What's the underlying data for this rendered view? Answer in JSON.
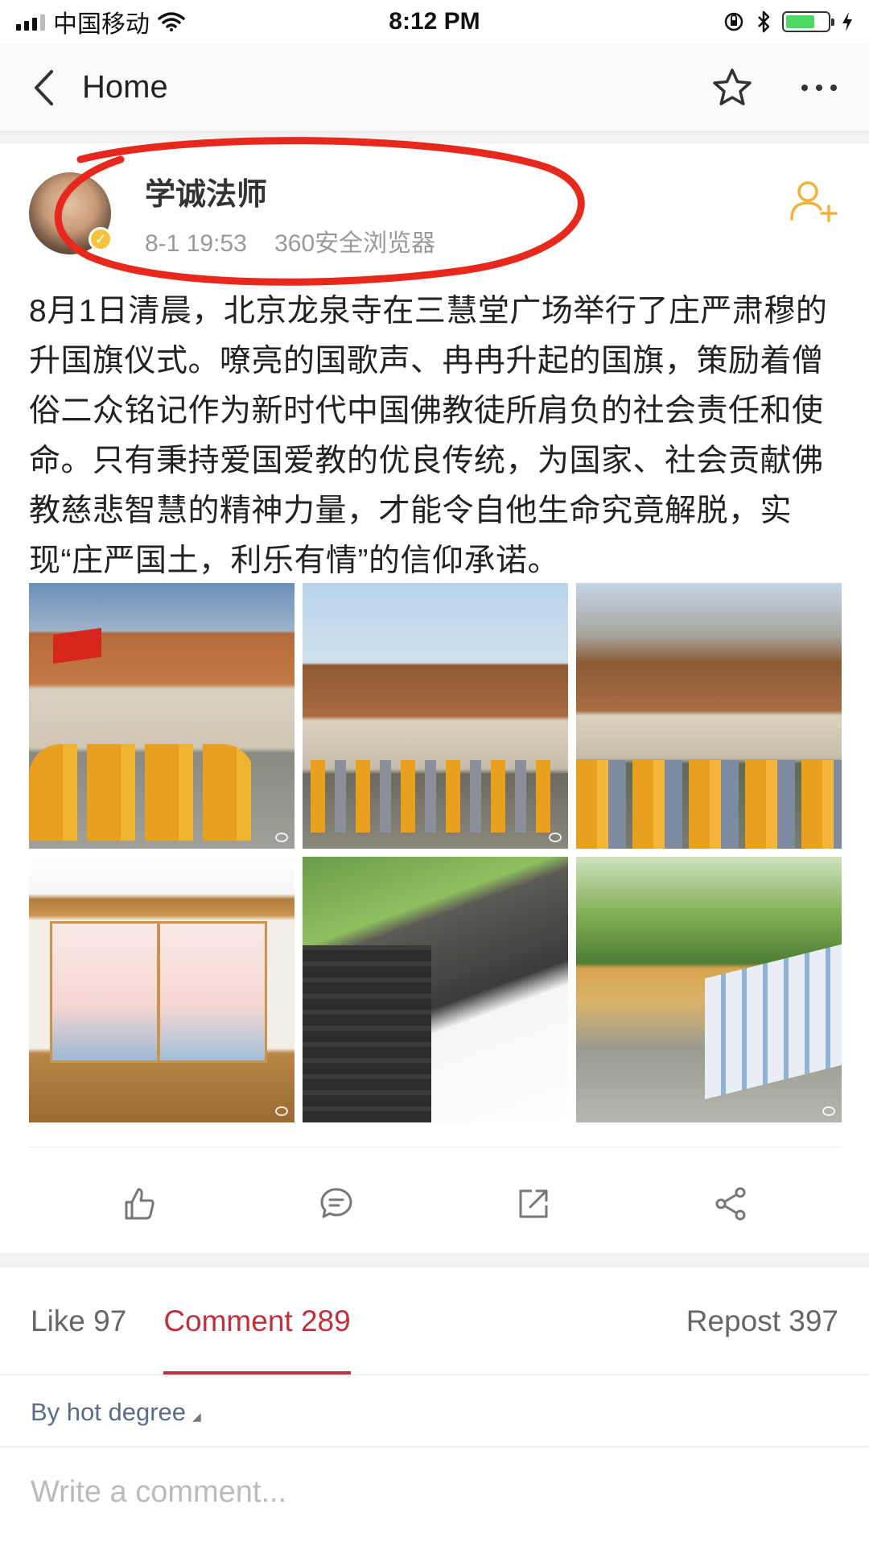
{
  "status_bar": {
    "carrier": "中国移动",
    "time": "8:12 PM",
    "signal_icon": "signal-icon",
    "wifi_icon": "wifi-icon",
    "battery_level": 0.7,
    "battery_color": "#4cd964"
  },
  "nav": {
    "back_label": "Home",
    "back_icon": "chevron-left-icon",
    "favorite_icon": "star-icon",
    "more_icon": "more-dots-icon"
  },
  "post": {
    "author": "学诚法师",
    "verified_badge": "✓",
    "date": "8-1 19:53",
    "source": "360安全浏览器",
    "follow_icon": "add-user-icon",
    "text": "8月1日清晨，北京龙泉寺在三慧堂广场举行了庄严肃穆的升国旗仪式。嘹亮的国歌声、冉冉升起的国旗，策励着僧俗二众铭记作为新时代中国佛教徒所肩负的社会责任和使命。只有秉持爱国爱教的优良传统，为国家、社会贡献佛教慈悲智慧的精神力量，才能令自他生命究竟解脱，实现“庄严国土，利乐有情”的信仰承诺。",
    "images": [
      "photo-1",
      "photo-2",
      "photo-3",
      "photo-4",
      "photo-5",
      "photo-6"
    ]
  },
  "annotation_color": "#e8281c",
  "actions": {
    "like_icon": "thumbs-up-icon",
    "comment_icon": "comment-icon",
    "repost_icon": "repost-icon",
    "share_icon": "share-icon"
  },
  "tabs": {
    "like": "Like 97",
    "comment": "Comment 289",
    "repost": "Repost 397",
    "active_color": "#c1313b"
  },
  "sort_label": "By hot degree",
  "comment_placeholder": "Write a comment..."
}
